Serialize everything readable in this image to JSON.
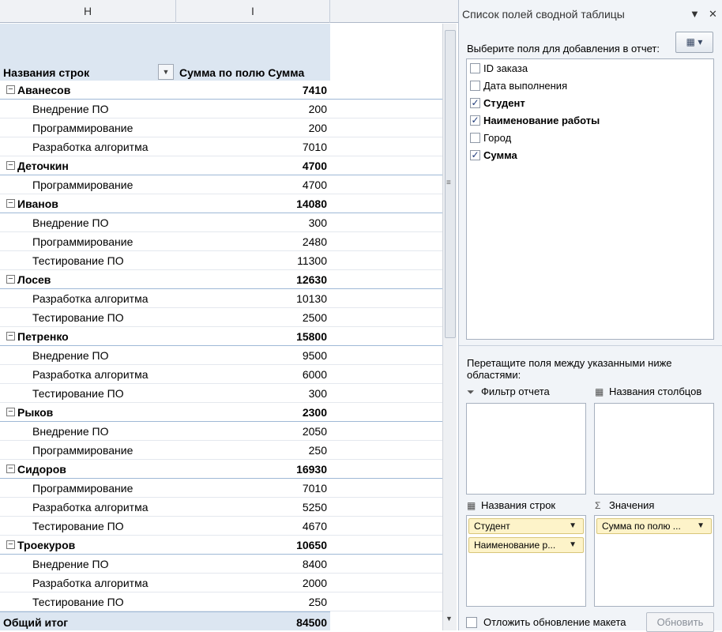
{
  "sheet": {
    "columns": [
      "H",
      "I"
    ],
    "header": {
      "row_label": "Названия строк",
      "sum_label": "Сумма по полю Сумма"
    },
    "groups": [
      {
        "name": "Аванесов",
        "total": "7410",
        "items": [
          {
            "name": "Внедрение ПО",
            "value": "200"
          },
          {
            "name": "Программирование",
            "value": "200"
          },
          {
            "name": "Разработка алгоритма",
            "value": "7010"
          }
        ]
      },
      {
        "name": "Деточкин",
        "total": "4700",
        "items": [
          {
            "name": "Программирование",
            "value": "4700"
          }
        ]
      },
      {
        "name": "Иванов",
        "total": "14080",
        "items": [
          {
            "name": "Внедрение ПО",
            "value": "300"
          },
          {
            "name": "Программирование",
            "value": "2480"
          },
          {
            "name": "Тестирование ПО",
            "value": "11300"
          }
        ]
      },
      {
        "name": "Лосев",
        "total": "12630",
        "items": [
          {
            "name": "Разработка алгоритма",
            "value": "10130"
          },
          {
            "name": "Тестирование ПО",
            "value": "2500"
          }
        ]
      },
      {
        "name": "Петренко",
        "total": "15800",
        "items": [
          {
            "name": "Внедрение ПО",
            "value": "9500"
          },
          {
            "name": "Разработка алгоритма",
            "value": "6000"
          },
          {
            "name": "Тестирование ПО",
            "value": "300"
          }
        ]
      },
      {
        "name": "Рыков",
        "total": "2300",
        "items": [
          {
            "name": "Внедрение ПО",
            "value": "2050"
          },
          {
            "name": "Программирование",
            "value": "250"
          }
        ]
      },
      {
        "name": "Сидоров",
        "total": "16930",
        "items": [
          {
            "name": "Программирование",
            "value": "7010"
          },
          {
            "name": "Разработка алгоритма",
            "value": "5250"
          },
          {
            "name": "Тестирование ПО",
            "value": "4670"
          }
        ]
      },
      {
        "name": "Троекуров",
        "total": "10650",
        "items": [
          {
            "name": "Внедрение ПО",
            "value": "8400"
          },
          {
            "name": "Разработка алгоритма",
            "value": "2000"
          },
          {
            "name": "Тестирование ПО",
            "value": "250"
          }
        ]
      }
    ],
    "grand_total": {
      "label": "Общий итог",
      "value": "84500"
    },
    "collapse_glyph": "⊟"
  },
  "pane": {
    "title": "Список полей сводной таблицы",
    "choose_label": "Выберите поля для добавления в отчет:",
    "fields": [
      {
        "name": "ID заказа",
        "checked": false
      },
      {
        "name": "Дата выполнения",
        "checked": false
      },
      {
        "name": "Студент",
        "checked": true
      },
      {
        "name": "Наименование работы",
        "checked": true
      },
      {
        "name": "Город",
        "checked": false
      },
      {
        "name": "Сумма",
        "checked": true
      }
    ],
    "drag_label": "Перетащите поля между указанными ниже областями:",
    "areas": {
      "filter": {
        "title": "Фильтр отчета",
        "icon": "filter-icon"
      },
      "columns": {
        "title": "Названия столбцов",
        "icon": "table-columns-icon"
      },
      "rows": {
        "title": "Названия строк",
        "icon": "table-rows-icon",
        "chips": [
          "Студент",
          "Наименование р..."
        ]
      },
      "values": {
        "title": "Значения",
        "icon": "sigma-icon",
        "chips": [
          "Сумма по полю ..."
        ]
      }
    },
    "defer_label": "Отложить обновление макета",
    "update_label": "Обновить"
  }
}
